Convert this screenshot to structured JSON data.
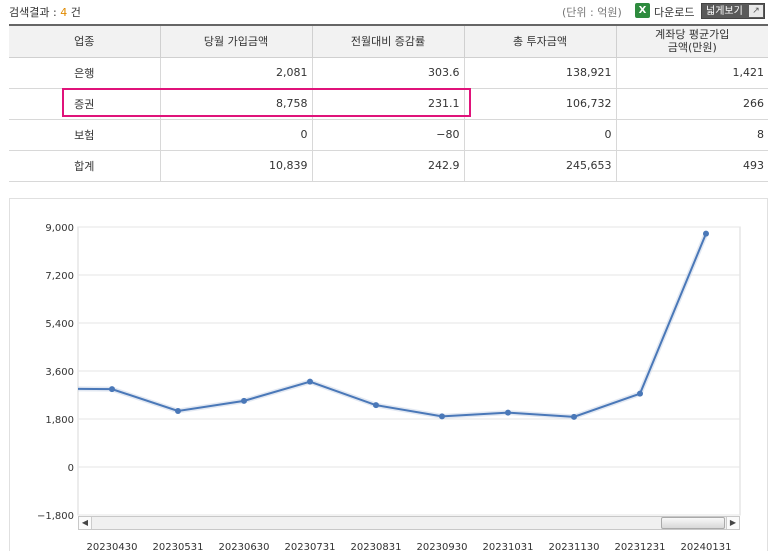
{
  "header": {
    "result_label": "검색결과 :",
    "result_count": "4",
    "result_unit": "건",
    "unit_note": "(단위 : 억원)",
    "download_icon": "excel-icon",
    "download_label": "다운로드",
    "wide_view_label": "넓게보기",
    "wide_view_icon": "expand-arrow-icon"
  },
  "table": {
    "headers": [
      "업종",
      "당월 가입금액",
      "전월대비 증감률",
      "총 투자금액",
      "계좌당 평균가입\n금액(만원)"
    ],
    "rows": [
      {
        "name": "은행",
        "monthly": "2,081",
        "change": "303.6",
        "total": "138,921",
        "avg": "1,421"
      },
      {
        "name": "증권",
        "monthly": "8,758",
        "change": "231.1",
        "total": "106,732",
        "avg": "266"
      },
      {
        "name": "보험",
        "monthly": "0",
        "change": "−80",
        "total": "0",
        "avg": "8"
      },
      {
        "name": "합계",
        "monthly": "10,839",
        "change": "242.9",
        "total": "245,653",
        "avg": "493"
      }
    ],
    "highlight_color": "#e0137a"
  },
  "chart_data": {
    "type": "line",
    "categories": [
      "20230430",
      "20230531",
      "20230630",
      "20230731",
      "20230831",
      "20230930",
      "20231031",
      "20231130",
      "20231231",
      "20240131"
    ],
    "series": [
      {
        "values": [
          2920,
          2100,
          2480,
          3200,
          2320,
          1900,
          2040,
          1880,
          2750,
          8750
        ],
        "color": "#4a78b8"
      }
    ],
    "start_value": 2930,
    "y_ticks": [
      "9,000",
      "7,200",
      "5,400",
      "3,600",
      "1,800",
      "0",
      "−1,800"
    ],
    "ylim": [
      -1800,
      9000
    ],
    "grid": true
  }
}
